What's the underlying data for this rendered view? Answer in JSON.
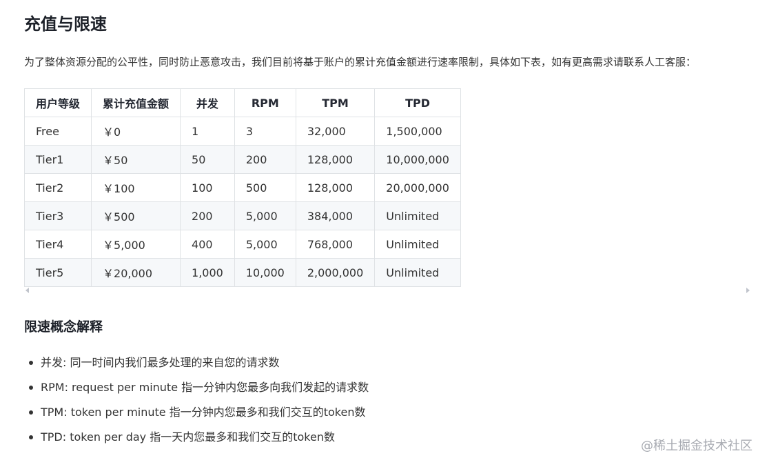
{
  "page": {
    "title": "充值与限速",
    "intro": "为了整体资源分配的公平性，同时防止恶意攻击，我们目前将基于账户的累计充值金额进行速率限制，具体如下表，如有更高需求请联系人工客服："
  },
  "table": {
    "headers": [
      "用户等级",
      "累计充值金额",
      "并发",
      "RPM",
      "TPM",
      "TPD"
    ],
    "rows": [
      [
        "Free",
        "￥0",
        "1",
        "3",
        "32,000",
        "1,500,000"
      ],
      [
        "Tier1",
        "￥50",
        "50",
        "200",
        "128,000",
        "10,000,000"
      ],
      [
        "Tier2",
        "￥100",
        "100",
        "500",
        "128,000",
        "20,000,000"
      ],
      [
        "Tier3",
        "￥500",
        "200",
        "5,000",
        "384,000",
        "Unlimited"
      ],
      [
        "Tier4",
        "￥5,000",
        "400",
        "5,000",
        "768,000",
        "Unlimited"
      ],
      [
        "Tier5",
        "￥20,000",
        "1,000",
        "10,000",
        "2,000,000",
        "Unlimited"
      ]
    ]
  },
  "concepts": {
    "title": "限速概念解释",
    "items": [
      "并发: 同一时间内我们最多处理的来自您的请求数",
      "RPM: request per minute 指一分钟内您最多向我们发起的请求数",
      "TPM: token per minute 指一分钟内您最多和我们交互的token数",
      "TPD: token per day 指一天内您最多和我们交互的token数"
    ]
  },
  "watermark": "@稀土掘金技术社区",
  "colors": {
    "text": "#333333",
    "heading": "#1d2129",
    "border": "#dfe2e5",
    "stripe": "#f6f8fa"
  }
}
